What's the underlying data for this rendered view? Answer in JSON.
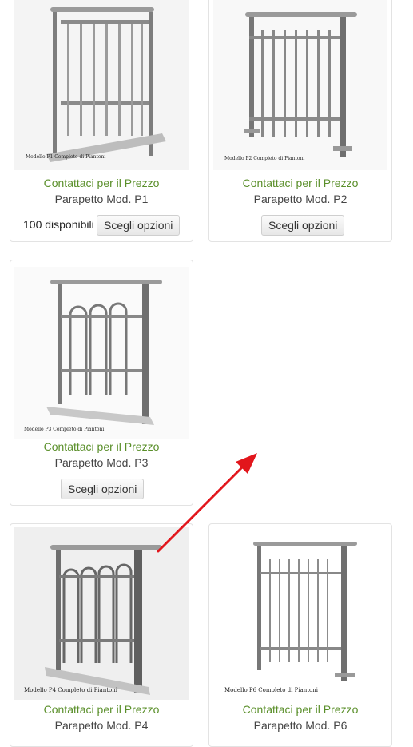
{
  "products": [
    {
      "caption": "Modello P1 Completo di Piantoni",
      "price": "Contattaci per il Prezzo",
      "name": "Parapetto Mod. P1",
      "stock": "100 disponibili",
      "button": "Scegli opzioni"
    },
    {
      "caption": "Modello P2 Completo di Piantoni",
      "price": "Contattaci per il Prezzo",
      "name": "Parapetto Mod. P2",
      "button": "Scegli opzioni"
    },
    {
      "caption": "Modello P3 Completo di Piantoni",
      "price": "Contattaci per il Prezzo",
      "name": "Parapetto Mod. P3",
      "button": "Scegli opzioni"
    },
    {
      "caption": "Modello P4 Completo di Piantoni",
      "price": "Contattaci per il Prezzo",
      "name": "Parapetto Mod. P4"
    },
    {
      "caption": "Modello P6 Completo di Piantoni",
      "price": "Contattaci per il Prezzo",
      "name": "Parapetto Mod. P6"
    }
  ],
  "colors": {
    "price": "#5a8f2a",
    "arrow": "#e2161c"
  }
}
